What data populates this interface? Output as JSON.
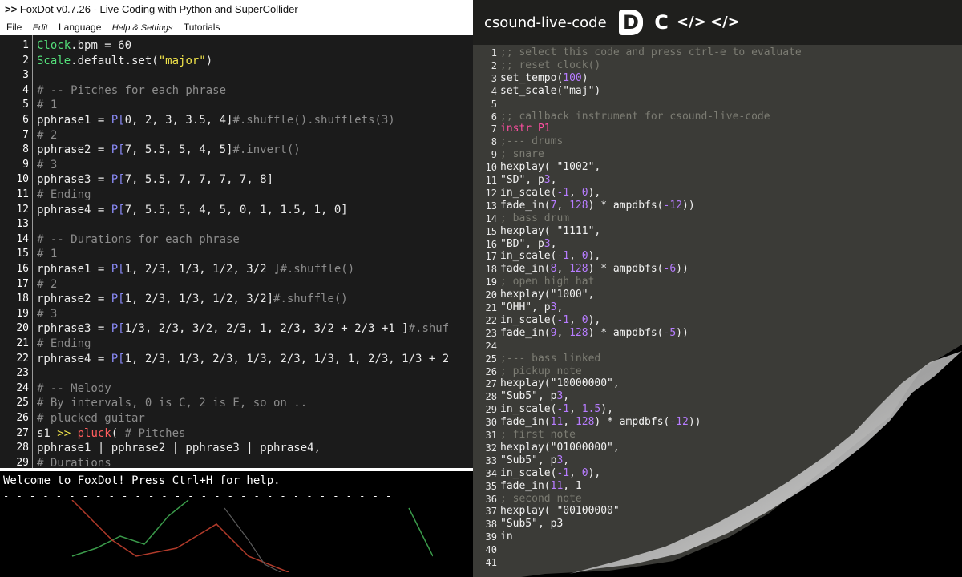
{
  "foxdot": {
    "title": "FoxDot v0.7.26 - Live Coding with Python and SuperCollider",
    "title_main": "FoxDot",
    "title_version": "v0.7.26 - Live Coding",
    "title_with": "with Python and SuperCollider",
    "menu": [
      "File",
      "Edit",
      "Language",
      "Help & Settings",
      "Tutorials"
    ],
    "lines": [
      {
        "n": "1",
        "code": "Clock.bpm = 60"
      },
      {
        "n": "2",
        "code": "Scale.default.set(\"major\")"
      },
      {
        "n": "3",
        "code": ""
      },
      {
        "n": "4",
        "code": "# -- Pitches for each phrase"
      },
      {
        "n": "5",
        "code": "# 1"
      },
      {
        "n": "6",
        "code": "pphrase1 = P[0, 2, 3, 3.5, 4]#.shuffle().shufflets(3)"
      },
      {
        "n": "7",
        "code": "# 2"
      },
      {
        "n": "8",
        "code": "pphrase2 = P[7, 5.5, 5, 4, 5]#.invert()"
      },
      {
        "n": "9",
        "code": "# 3"
      },
      {
        "n": "10",
        "code": "pphrase3 = P[7, 5.5, 7, 7, 7, 7, 8]"
      },
      {
        "n": "11",
        "code": "# Ending"
      },
      {
        "n": "12",
        "code": "pphrase4 = P[7, 5.5, 5, 4, 5, 0, 1, 1.5, 1, 0]"
      },
      {
        "n": "13",
        "code": ""
      },
      {
        "n": "14",
        "code": "# -- Durations for each phrase"
      },
      {
        "n": "15",
        "code": "# 1"
      },
      {
        "n": "16",
        "code": "rphrase1 = P[1, 2/3, 1/3, 1/2, 3/2 ]#.shuffle()"
      },
      {
        "n": "17",
        "code": "# 2"
      },
      {
        "n": "18",
        "code": "rphrase2 = P[1, 2/3, 1/3, 1/2, 3/2]#.shuffle()"
      },
      {
        "n": "19",
        "code": "# 3"
      },
      {
        "n": "20",
        "code": "rphrase3 = P[1/3, 2/3, 3/2, 2/3, 1, 2/3, 3/2 + 2/3 +1 ]#.shuf"
      },
      {
        "n": "21",
        "code": "# Ending"
      },
      {
        "n": "22",
        "code": "rphrase4 = P[1, 2/3, 1/3, 2/3, 1/3, 2/3, 1/3, 1, 2/3, 1/3 + 2"
      },
      {
        "n": "23",
        "code": ""
      },
      {
        "n": "24",
        "code": "# -- Melody"
      },
      {
        "n": "25",
        "code": "# By intervals, 0 is C, 2 is E, so on .."
      },
      {
        "n": "26",
        "code": "# plucked guitar"
      },
      {
        "n": "27",
        "code": "s1 >> pluck(    # Pitches"
      },
      {
        "n": "28",
        "code": "               pphrase1 | pphrase2 | pphrase3 | pphrase4,"
      },
      {
        "n": "29",
        "code": "               # Durations"
      }
    ],
    "console": {
      "welcome": "Welcome to FoxDot! Press Ctrl+H for help.",
      "dashes": "- - - - - - - - - - - - - - - - - - - - - - - - - - - - - -"
    },
    "colors": {
      "background": "#1b1b1b",
      "keyword": "#54e07a",
      "number": "#f2a23a",
      "pattern": "#8a8af5"
    }
  },
  "csound": {
    "title": "csound-live-code",
    "buttons": [
      {
        "name": "evaluate-button",
        "label": "D"
      },
      {
        "name": "clear-button",
        "label": "C"
      },
      {
        "name": "code-button-1",
        "label": "</>"
      },
      {
        "name": "code-button-2",
        "label": "</>"
      }
    ],
    "lines": [
      {
        "n": "1",
        "code": ";; select this code and press ctrl-e to evaluate"
      },
      {
        "n": "2",
        "code": ";; reset clock()"
      },
      {
        "n": "3",
        "code": "set_tempo(100)"
      },
      {
        "n": "4",
        "code": "set_scale(\"maj\")"
      },
      {
        "n": "5",
        "code": ""
      },
      {
        "n": "6",
        "code": ";; callback instrument for csound-live-code"
      },
      {
        "n": "7",
        "code": "instr P1"
      },
      {
        "n": "8",
        "code": ";--- drums"
      },
      {
        "n": "9",
        "code": "; snare"
      },
      {
        "n": "10",
        "code": "hexplay( \"1002\","
      },
      {
        "n": "11",
        "code": "        \"SD\", p3,"
      },
      {
        "n": "12",
        "code": "        in_scale(-1, 0),"
      },
      {
        "n": "13",
        "code": "        fade_in(7, 128) * ampdbfs(-12))"
      },
      {
        "n": "14",
        "code": "; bass drum"
      },
      {
        "n": "15",
        "code": "hexplay( \"1111\","
      },
      {
        "n": "16",
        "code": "        \"BD\", p3,"
      },
      {
        "n": "17",
        "code": "        in_scale(-1, 0),"
      },
      {
        "n": "18",
        "code": "        fade_in(8, 128) * ampdbfs(-6))"
      },
      {
        "n": "19",
        "code": "; open high hat"
      },
      {
        "n": "20",
        "code": "hexplay(\"1000\","
      },
      {
        "n": "21",
        "code": "   \"OHH\", p3,"
      },
      {
        "n": "22",
        "code": "   in_scale(-1, 0),"
      },
      {
        "n": "23",
        "code": "   fade_in(9, 128) * ampdbfs(-5))"
      },
      {
        "n": "24",
        "code": ""
      },
      {
        "n": "25",
        "code": ";--- bass linked"
      },
      {
        "n": "26",
        "code": "; pickup note"
      },
      {
        "n": "27",
        "code": "hexplay(\"10000000\","
      },
      {
        "n": "28",
        "code": "        \"Sub5\", p3,"
      },
      {
        "n": "29",
        "code": "        in_scale(-1, 1.5),"
      },
      {
        "n": "30",
        "code": "        fade_in(11, 128) * ampdbfs(-12))"
      },
      {
        "n": "31",
        "code": "; first note"
      },
      {
        "n": "32",
        "code": "hexplay(\"01000000\","
      },
      {
        "n": "33",
        "code": "        \"Sub5\", p3,"
      },
      {
        "n": "34",
        "code": "        in_scale(-1, 0),"
      },
      {
        "n": "35",
        "code": "        fade_in(11, 1"
      },
      {
        "n": "36",
        "code": "; second note"
      },
      {
        "n": "37",
        "code": "hexplay(  \"00100000\""
      },
      {
        "n": "38",
        "code": "        \"Sub5\", p3"
      },
      {
        "n": "39",
        "code": "        in"
      },
      {
        "n": "40",
        "code": ""
      },
      {
        "n": "41",
        "code": ""
      }
    ],
    "colors": {
      "background": "#3b3b37",
      "header": "#1f1f1d",
      "comment": "#7c7c73",
      "instr": "#ff4fa2",
      "number": "#b77cff"
    }
  }
}
